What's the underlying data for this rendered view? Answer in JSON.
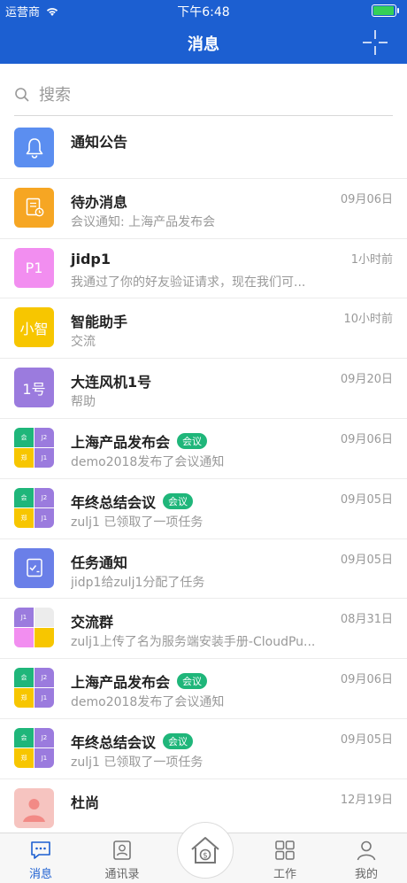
{
  "status": {
    "carrier": "运营商",
    "time": "下午6:48",
    "battery_level": 0.9
  },
  "nav": {
    "title": "消息"
  },
  "search": {
    "placeholder": "搜索"
  },
  "colors": {
    "primary": "#1c5fd1",
    "tag": "#1fb67a"
  },
  "messages": [
    {
      "title": "通知公告",
      "subtitle": "",
      "time": "",
      "tag": "",
      "avatar": {
        "type": "icon",
        "icon": "bell-icon",
        "color": "#5b8ef0"
      }
    },
    {
      "title": "待办消息",
      "subtitle": "会议通知: 上海产品发布会",
      "time": "09月06日",
      "tag": "",
      "avatar": {
        "type": "icon",
        "icon": "todo-doc-icon",
        "color": "#f6a623"
      }
    },
    {
      "title": "jidp1",
      "subtitle": "我通过了你的好友验证请求，现在我们可...",
      "time": "1小时前",
      "tag": "",
      "avatar": {
        "type": "text",
        "text": "P1",
        "color": "#f28ef0"
      }
    },
    {
      "title": "智能助手",
      "subtitle": "交流",
      "time": "10小时前",
      "tag": "",
      "avatar": {
        "type": "text",
        "text": "小智",
        "color": "#f7c600"
      }
    },
    {
      "title": "大连风机1号",
      "subtitle": "帮助",
      "time": "09月20日",
      "tag": "",
      "avatar": {
        "type": "text",
        "text": "1号",
        "color": "#9b7bde"
      }
    },
    {
      "title": "上海产品发布会",
      "subtitle": "demo2018发布了会议通知",
      "time": "09月06日",
      "tag": "会议",
      "avatar": {
        "type": "group"
      }
    },
    {
      "title": "年终总结会议",
      "subtitle": "zulj1 已领取了一项任务",
      "time": "09月05日",
      "tag": "会议",
      "avatar": {
        "type": "group"
      }
    },
    {
      "title": "任务通知",
      "subtitle": "jidp1给zulj1分配了任务",
      "time": "09月05日",
      "tag": "",
      "avatar": {
        "type": "icon",
        "icon": "task-icon",
        "color": "#6a7fe8"
      }
    },
    {
      "title": "交流群",
      "subtitle": "zulj1上传了名为服务端安装手册-CloudPu...",
      "time": "08月31日",
      "tag": "",
      "avatar": {
        "type": "group2"
      }
    },
    {
      "title": "上海产品发布会",
      "subtitle": "demo2018发布了会议通知",
      "time": "09月06日",
      "tag": "会议",
      "avatar": {
        "type": "group"
      }
    },
    {
      "title": "年终总结会议",
      "subtitle": "zulj1 已领取了一项任务",
      "time": "09月05日",
      "tag": "会议",
      "avatar": {
        "type": "group"
      }
    },
    {
      "title": "杜尚",
      "subtitle": "",
      "time": "12月19日",
      "tag": "",
      "avatar": {
        "type": "photo",
        "color": "#f6c4c0"
      }
    }
  ],
  "tabs": [
    {
      "label": "消息",
      "icon": "chat-icon"
    },
    {
      "label": "通讯录",
      "icon": "contacts-icon"
    },
    {
      "label": "",
      "icon": "home-icon"
    },
    {
      "label": "工作",
      "icon": "apps-grid-icon"
    },
    {
      "label": "我的",
      "icon": "profile-icon"
    }
  ]
}
